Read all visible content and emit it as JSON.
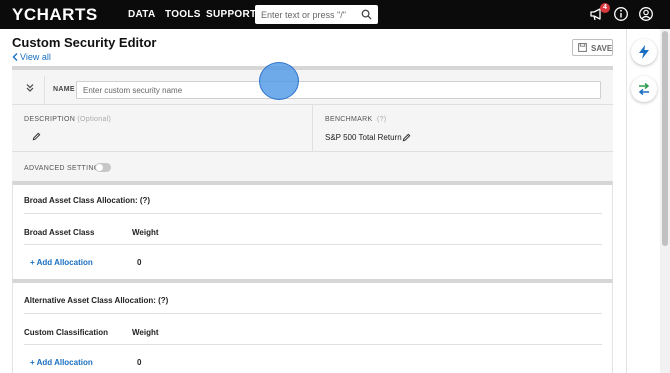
{
  "nav": {
    "logo": "YCHARTS",
    "links": [
      "DATA",
      "TOOLS",
      "SUPPORT"
    ],
    "search_placeholder": "Enter text or press \"/\"",
    "notification_count": "4"
  },
  "header": {
    "title": "Custom Security Editor",
    "view_all": "View all",
    "save_label": "SAVE"
  },
  "editor": {
    "name_label": "NAME",
    "name_placeholder": "Enter custom security name",
    "name_value": "",
    "description_label": "DESCRIPTION",
    "description_optional": "(Optional)",
    "benchmark_label": "BENCHMARK",
    "benchmark_help": "(?)",
    "benchmark_value": "S&P 500 Total Return",
    "advanced_label": "ADVANCED SETTINGS",
    "advanced_enabled": false
  },
  "sections": [
    {
      "title": "Broad Asset Class Allocation: (?)",
      "col1": "Broad Asset Class",
      "col2": "Weight",
      "add_label": "+ Add Allocation",
      "weight_total": "0"
    },
    {
      "title": "Alternative Asset Class Allocation: (?)",
      "col1": "Custom Classification",
      "col2": "Weight",
      "add_label": "+ Add Allocation",
      "weight_total": "0"
    }
  ],
  "colors": {
    "accent": "#1a6fc0",
    "topbar": "#0b0b0b",
    "badge": "#d9363e",
    "rail_icon": "#1a6fc0",
    "rail_icon_green": "#2e9b4f"
  },
  "icons": [
    "search-icon",
    "megaphone-icon",
    "info-icon",
    "user-icon",
    "lightning-icon",
    "swap-icon",
    "pencil-icon",
    "chevron-double-down-icon",
    "save-icon"
  ]
}
